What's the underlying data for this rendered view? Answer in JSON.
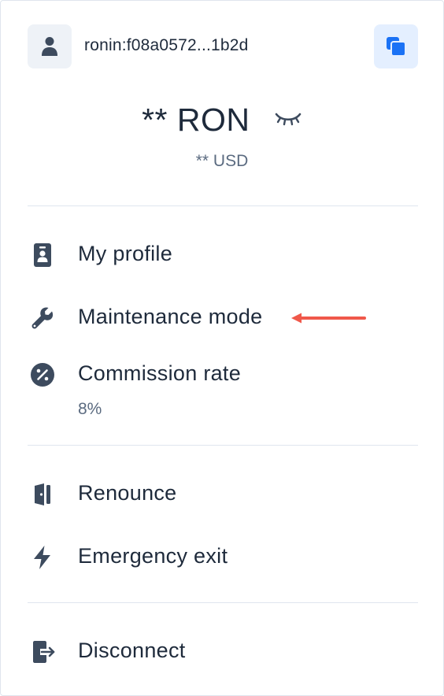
{
  "wallet": {
    "address": "ronin:f08a0572...1b2d",
    "balance": "** RON",
    "balance_usd": "** USD",
    "icons": {
      "avatar": "user-icon",
      "copy": "copy-icon",
      "hide": "eye-closed-icon"
    }
  },
  "menu": {
    "profile": {
      "label": "My profile",
      "icon": "profile-card-icon"
    },
    "maintenance": {
      "label": "Maintenance mode",
      "icon": "wrench-icon"
    },
    "commission": {
      "label": "Commission rate",
      "value": "8%",
      "icon": "percent-icon"
    },
    "renounce": {
      "label": "Renounce",
      "icon": "door-icon"
    },
    "emergency": {
      "label": "Emergency exit",
      "icon": "lightning-icon"
    },
    "disconnect": {
      "label": "Disconnect",
      "icon": "logout-icon"
    }
  },
  "annotation": {
    "color": "#f0584a"
  },
  "colors": {
    "text": "#1e2a3b",
    "muted": "#5b6b80",
    "icon": "#3d4b5e",
    "accent": "#1b72f5",
    "accent_bg": "#e4efff",
    "divider": "#dfe5ee"
  }
}
